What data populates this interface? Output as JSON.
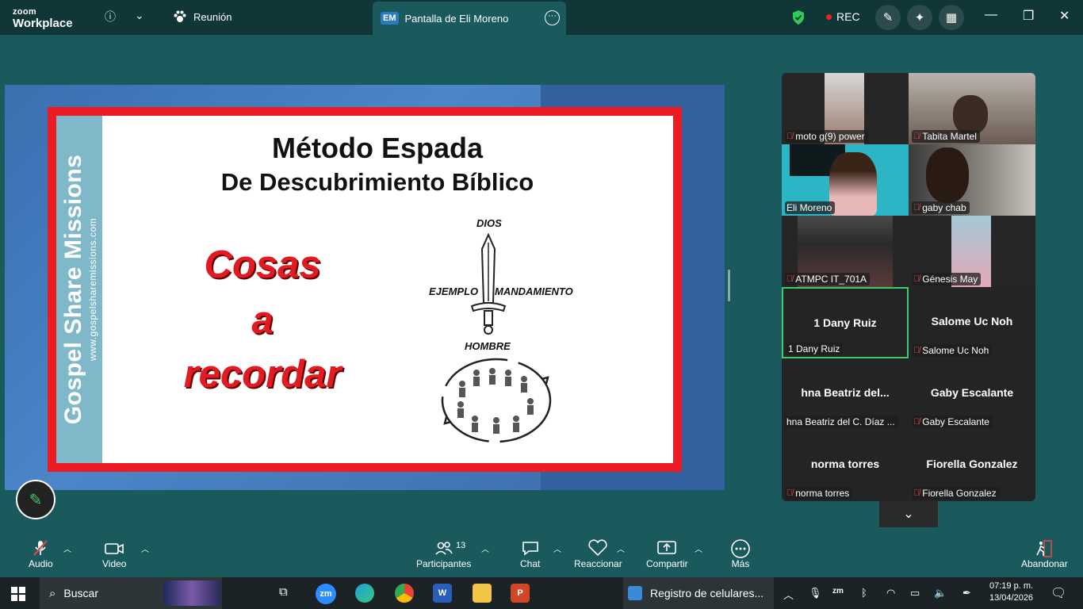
{
  "app": {
    "brand_top": "zoom",
    "brand_bottom": "Workplace"
  },
  "titlebar": {
    "meeting_tab": "Reunión",
    "share_tab_badge": "EM",
    "share_tab_label": "Pantalla de Eli Moreno",
    "rec_label": "REC"
  },
  "slide": {
    "vertical_title": "Gospel Share Missions",
    "vertical_url": "www.gospelsharemissions.com",
    "title_line1": "Método Espada",
    "title_line2": "De Descubrimiento Bíblico",
    "red_lines": [
      "Cosas",
      "a",
      "recordar"
    ],
    "label_top": "DIOS",
    "label_left": "EJEMPLO",
    "label_right": "MANDAMIENTO",
    "label_bottom": "HOMBRE"
  },
  "gallery": {
    "video_tiles": [
      {
        "name": "moto g(9) power",
        "muted": true
      },
      {
        "name": "Tabita Martel",
        "muted": true
      },
      {
        "name": "Eli Moreno",
        "muted": false
      },
      {
        "name": "gaby chab",
        "muted": true
      },
      {
        "name": "ATMPC IT_701A",
        "muted": true
      },
      {
        "name": "Génesis May",
        "muted": true
      }
    ],
    "name_tiles": [
      {
        "center": "1 Dany Ruiz",
        "tag": "1 Dany Ruiz",
        "muted": false,
        "active": true
      },
      {
        "center": "Salome Uc Noh",
        "tag": "Salome Uc Noh",
        "muted": true,
        "active": false
      },
      {
        "center": "hna  Beatriz del...",
        "tag": "hna Beatriz del C. Díaz  ...",
        "muted": false,
        "active": false
      },
      {
        "center": "Gaby Escalante",
        "tag": "Gaby Escalante",
        "muted": true,
        "active": false
      },
      {
        "center": "norma torres",
        "tag": "norma torres",
        "muted": true,
        "active": false
      },
      {
        "center": "Fiorella Gonzalez",
        "tag": "Fiorella Gonzalez",
        "muted": true,
        "active": false
      }
    ]
  },
  "toolbar": {
    "audio": "Audio",
    "video": "Video",
    "participants": "Participantes",
    "participants_count": "13",
    "chat": "Chat",
    "react": "Reaccionar",
    "share": "Compartir",
    "more": "Más",
    "leave": "Abandonar"
  },
  "taskbar": {
    "search_placeholder": "Buscar",
    "running_app_label": "Registro de celulares...",
    "time": "07:19 p. m.",
    "date": "13/04/2026"
  },
  "colors": {
    "meeting_bg": "#1a5a5c",
    "titlebar_bg": "#103638",
    "slide_border": "#ec1c24",
    "active_speaker": "#3dcc6a",
    "rec_dot": "#ee2222"
  }
}
